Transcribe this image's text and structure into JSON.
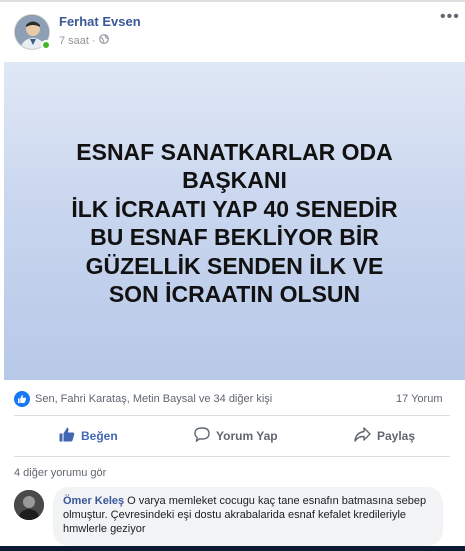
{
  "post": {
    "author": "Ferhat Evsen",
    "time": "7 saat",
    "separator": "·",
    "image_text_lines": [
      "ESNAF SANATKARLAR ODA",
      "BAŞKANI",
      "İLK İCRAATI YAP 40 SENEDİR",
      "BU ESNAF BEKLİYOR BİR",
      "GÜZELLİK SENDEN İLK VE",
      "SON İCRAATIN OLSUN"
    ]
  },
  "reactions": {
    "text": "Sen, Fahri Karataş, Metin Baysal ve 34 diğer kişi",
    "comment_count": "17 Yorum"
  },
  "actions": {
    "like": "Beğen",
    "comment": "Yorum Yap",
    "share": "Paylaş"
  },
  "comments": {
    "more_link": "4 diğer yorumu gör",
    "first": {
      "author": "Ömer Keleş",
      "text": "O varya memleket cocugu kaç tane esnafın batmasına sebep olmuştur. Çevresindeki eşi dostu akrabalarida esnaf kefalet kredileriyle hmwlerle geziyor"
    }
  },
  "colors": {
    "link": "#385898",
    "like_blue": "#1877f2",
    "online": "#42b72a"
  },
  "icons": [
    "globe-icon",
    "more-options-icon",
    "like-reaction-icon",
    "thumbs-up-icon",
    "comment-icon",
    "share-icon"
  ]
}
